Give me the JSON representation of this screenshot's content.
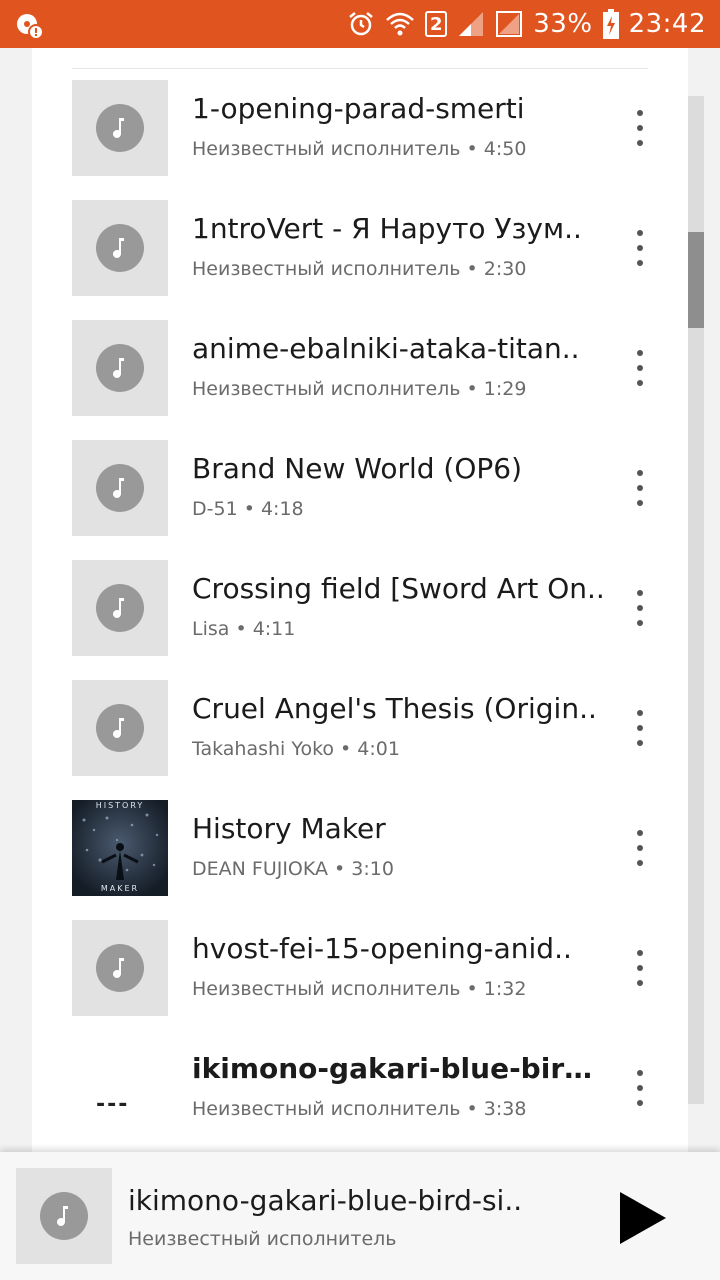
{
  "status_bar": {
    "battery_percent": "33%",
    "time": "23:42",
    "sim_slot": "2",
    "background_color": "#e0541f"
  },
  "songs": [
    {
      "title": "1-opening-parad-smerti",
      "subtitle": "Неизвестный исполнитель • 4:50",
      "thumb": "music-note-icon",
      "bold": false
    },
    {
      "title": "1ntroVert - Я Наруто Узум..",
      "subtitle": "Неизвестный исполнитель • 2:30",
      "thumb": "music-note-icon",
      "bold": false
    },
    {
      "title": "anime-ebalniki-ataka-titan..",
      "subtitle": "Неизвестный исполнитель • 1:29",
      "thumb": "music-note-icon",
      "bold": false
    },
    {
      "title": "Brand New World (OP6)",
      "subtitle": "D-51 • 4:18",
      "thumb": "music-note-icon",
      "bold": false
    },
    {
      "title": "Crossing field [Sword Art On..",
      "subtitle": "Lisa • 4:11",
      "thumb": "music-note-icon",
      "bold": false
    },
    {
      "title": "Cruel Angel's Thesis (Origin..",
      "subtitle": "Takahashi Yoko • 4:01",
      "thumb": "music-note-icon",
      "bold": false
    },
    {
      "title": "History Maker",
      "subtitle": "DEAN FUJIOKA • 3:10",
      "thumb": "album-art",
      "art_text_top": "HISTORY",
      "art_text_bottom": "MAKER",
      "bold": false
    },
    {
      "title": "hvost-fei-15-opening-anid..",
      "subtitle": "Неизвестный исполнитель • 1:32",
      "thumb": "music-note-icon",
      "bold": false
    },
    {
      "title": "ikimono-gakari-blue-bird-s..",
      "subtitle": "Неизвестный исполнитель • 3:38",
      "thumb": "now-playing-indicator",
      "indicator": "---",
      "bold": true
    }
  ],
  "player": {
    "title": "ikimono-gakari-blue-bird-si..",
    "artist": "Неизвестный исполнитель",
    "play_icon": "play-icon"
  }
}
